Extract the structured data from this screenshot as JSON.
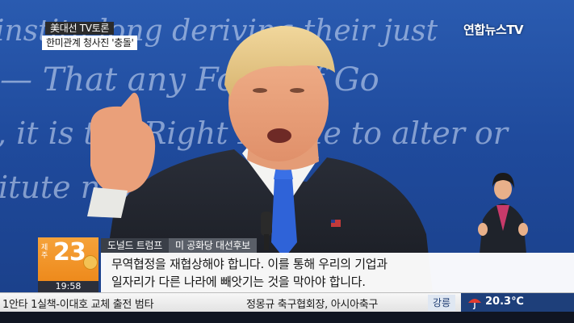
{
  "captions": {
    "top_line": "美대선 TV토론",
    "second_line": "한미관계 청사진 '충돌'"
  },
  "channel": {
    "logo_text": "연합뉴스TV"
  },
  "background_text": {
    "line1": "institu  long  deriving  their just",
    "line2": "— That  any Form of Go",
    "line3": ", it is the Right  People to alter or",
    "line4": "itute new  such for"
  },
  "weather_box": {
    "location": "제주",
    "temperature": "23",
    "clock": "19:58"
  },
  "nameplate": {
    "name": "도널드 트럼프",
    "role": "미 공화당 대선후보"
  },
  "subtitle": {
    "line1": "무역협정을 재협상해야 합니다. 이를 통해 우리의 기업과",
    "line2": "일자리가 다른 나라에 빼앗기는 것을 막아야 합니다."
  },
  "ticker": {
    "left_text": "1안타 1실책-이대호 교체 출전 범타",
    "right_text": "정몽규 축구협회장, 아시아축구",
    "weather_city": "강릉",
    "weather_temp": "20.3℃",
    "weather_icon": "umbrella-icon"
  },
  "colors": {
    "backdrop_blue": "#2a5bb0",
    "temp_orange": "#f39a2c",
    "ticker_panel": "#1e3f7a"
  }
}
